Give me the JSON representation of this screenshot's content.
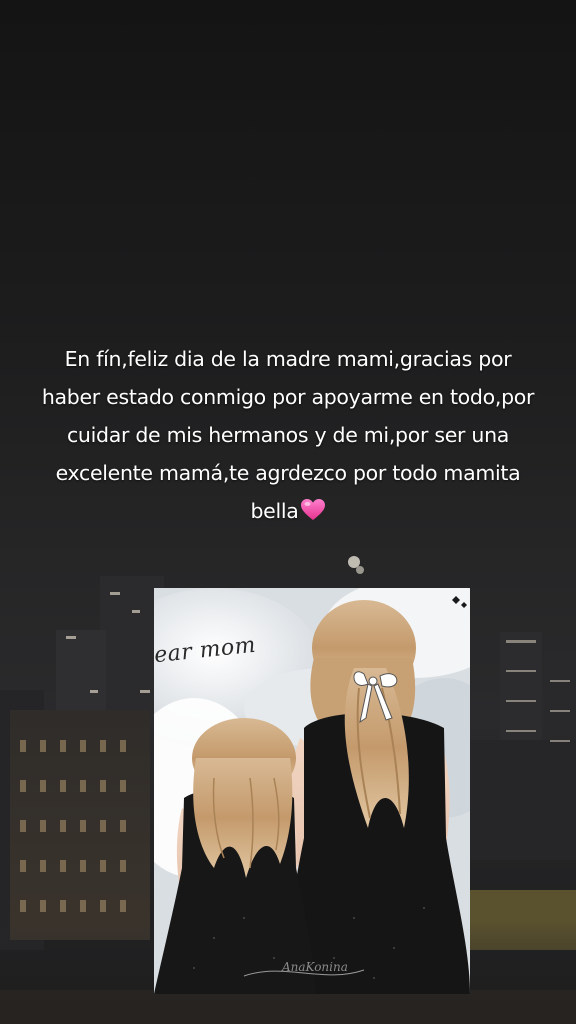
{
  "post": {
    "caption": "En fín,feliz dia de la madre mami,gracias por haber estado conmigo por apoyarme en todo,por cuidar de mis hermanos y de mi,por ser una excelente mamá,te agrdezco por todo mamita bella",
    "caption_emoji": "heart-icon"
  },
  "artwork": {
    "script_text": "ear mom",
    "signature": "AnaKonina"
  },
  "colors": {
    "caption_text": "#ffffff",
    "heart": "#ff4fb0",
    "dress": "#161616",
    "hair": "#c9a47a",
    "background": "#1c1c1d"
  }
}
